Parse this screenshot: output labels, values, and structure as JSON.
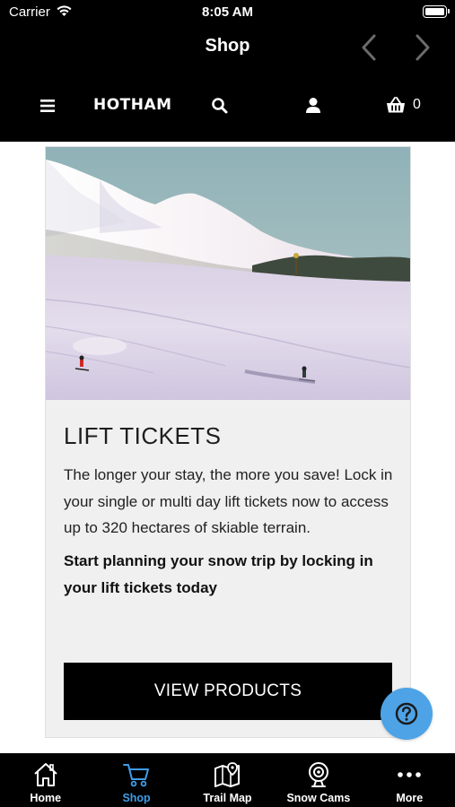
{
  "status_bar": {
    "carrier": "Carrier",
    "time": "8:05 AM"
  },
  "nav_bar": {
    "title": "Shop"
  },
  "site_header": {
    "logo_text": "HOTHAM",
    "cart_count": "0"
  },
  "card": {
    "title": "LIFT TICKETS",
    "description": "The longer your stay, the more you save! Lock in your single or multi day lift tickets now to access up to 320 hectares of skiable terrain.",
    "cta_text": "Start planning your snow trip by locking in your lift tickets today",
    "button_label": "VIEW PRODUCTS"
  },
  "tab_bar": {
    "tabs": [
      {
        "label": "Home",
        "icon": "home-icon",
        "active": false
      },
      {
        "label": "Shop",
        "icon": "cart-icon",
        "active": true
      },
      {
        "label": "Trail Map",
        "icon": "map-icon",
        "active": false
      },
      {
        "label": "Snow Cams",
        "icon": "webcam-icon",
        "active": false
      },
      {
        "label": "More",
        "icon": "more-icon",
        "active": false
      }
    ]
  },
  "colors": {
    "bar_background": "#000000",
    "active_tab": "#3e9ce8",
    "help_fab": "#4da3e6",
    "card_background": "#f0f0f0"
  }
}
